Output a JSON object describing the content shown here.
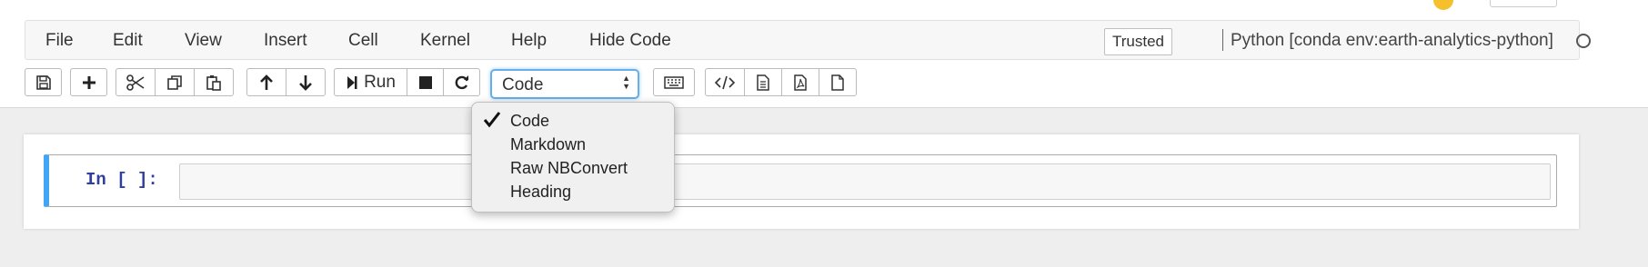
{
  "menu": {
    "items": [
      {
        "label": "File"
      },
      {
        "label": "Edit"
      },
      {
        "label": "View"
      },
      {
        "label": "Insert"
      },
      {
        "label": "Cell"
      },
      {
        "label": "Kernel"
      },
      {
        "label": "Help"
      },
      {
        "label": "Hide Code"
      }
    ],
    "trusted_label": "Trusted",
    "kernel_name": "Python [conda env:earth-analytics-python]"
  },
  "toolbar": {
    "run_label": "Run",
    "cell_type_value": "Code",
    "icons": [
      "save-icon",
      "plus-icon",
      "scissors-icon",
      "copy-icon",
      "paste-icon",
      "arrow-up-icon",
      "arrow-down-icon",
      "step-forward-icon",
      "stop-icon",
      "restart-icon",
      "keyboard-icon",
      "code-icon",
      "document-icon",
      "pdf-icon",
      "blank-page-icon"
    ]
  },
  "cell_type_menu": {
    "selected": "Code",
    "options": [
      "Code",
      "Markdown",
      "Raw NBConvert",
      "Heading"
    ]
  },
  "cell": {
    "prompt": "In [ ]:"
  },
  "colors": {
    "selected_cell_bar": "#42a5f5",
    "prompt_text": "#303f9f",
    "focus_outline": "#66afe9"
  }
}
